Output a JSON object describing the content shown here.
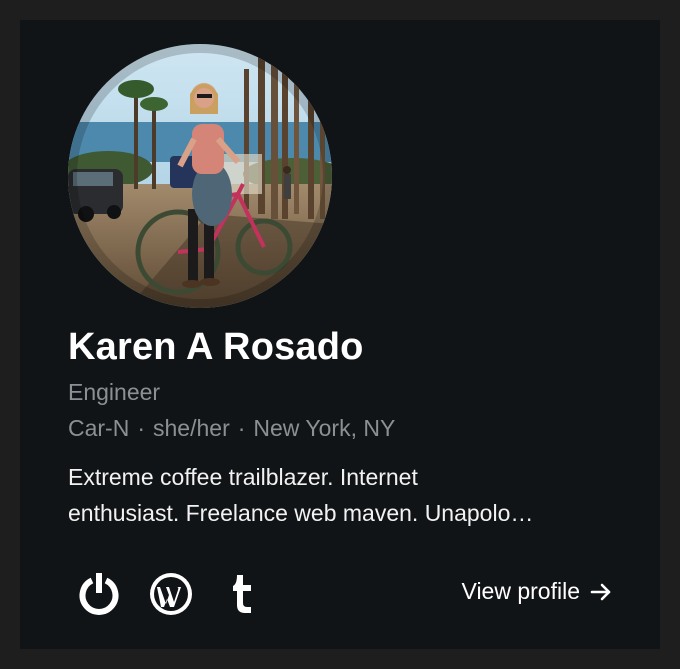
{
  "profile": {
    "name": "Karen A Rosado",
    "title": "Engineer",
    "company": "Car-N",
    "pronouns": "she/her",
    "location": "New York, NY",
    "separator": "·",
    "bio_line1": "Extreme coffee trailblazer. Internet",
    "bio_line2": "enthusiast. Freelance web maven. Unapolo…"
  },
  "social": [
    {
      "icon": "power-icon"
    },
    {
      "icon": "wordpress-icon"
    },
    {
      "icon": "tumblr-icon"
    }
  ],
  "actions": {
    "view_profile_label": "View profile",
    "view_profile_icon": "arrow-right-icon"
  },
  "colors": {
    "card_background": "#111416",
    "page_background": "#1e1e1f",
    "name": "#ffffff",
    "secondary_text": "#8c9094",
    "bio_text": "#f2f2f2"
  }
}
